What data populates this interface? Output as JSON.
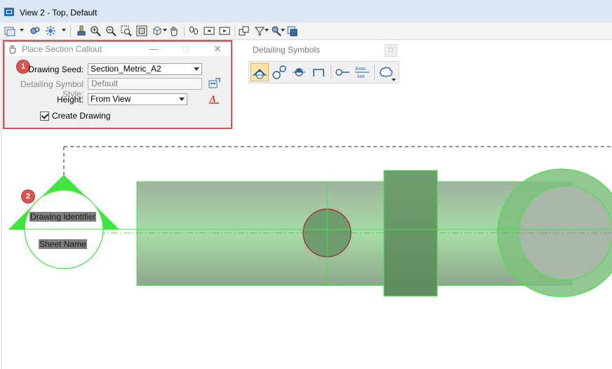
{
  "window": {
    "title": "View 2 - Top, Default"
  },
  "toolbar": {
    "icons": [
      "view-display-icon",
      "view-attributes-icon",
      "lights-icon",
      "render-icon",
      "zoom-in-icon",
      "zoom-out-icon",
      "window-area-icon",
      "fit-view-icon",
      "rotate-view-icon",
      "pan-view-icon",
      "walk-icon",
      "previous-view-icon",
      "next-view-icon",
      "copy-view-icon",
      "clip-volume-icon",
      "clip-mask-icon",
      "change-view-perspective-icon"
    ]
  },
  "dialog": {
    "title": "Place Section Callout",
    "drawing_seed_label": "Drawing Seed:",
    "drawing_seed_value": "Section_Metric_A2",
    "symbol_style_label": "Detailing Symbol Style:",
    "symbol_style_value": "Default",
    "height_label": "Height:",
    "height_value": "From View",
    "create_drawing_label": "Create Drawing",
    "create_drawing_checked": true
  },
  "detailing_symbols": {
    "title": "Detailing Symbols",
    "tools": [
      "section-callout-icon",
      "detail-callout-icon",
      "elevation-callout-icon",
      "interior-elevation-icon",
      "title-text-icon",
      "drawing-title-icon",
      "cloud-icon"
    ],
    "drawing_title_glyph_top": "Xxxx",
    "drawing_title_glyph_bottom": "xxx"
  },
  "callout": {
    "drawing_identifier": "Drawing Identifier",
    "sheet_name": "Sheet Name"
  },
  "markers": [
    "1",
    "2"
  ],
  "colors": {
    "callout_green": "#3ee63e",
    "model_green": "#8fd38f",
    "highlight_red": "#d9534f",
    "active_tool": "#fde3a7"
  }
}
